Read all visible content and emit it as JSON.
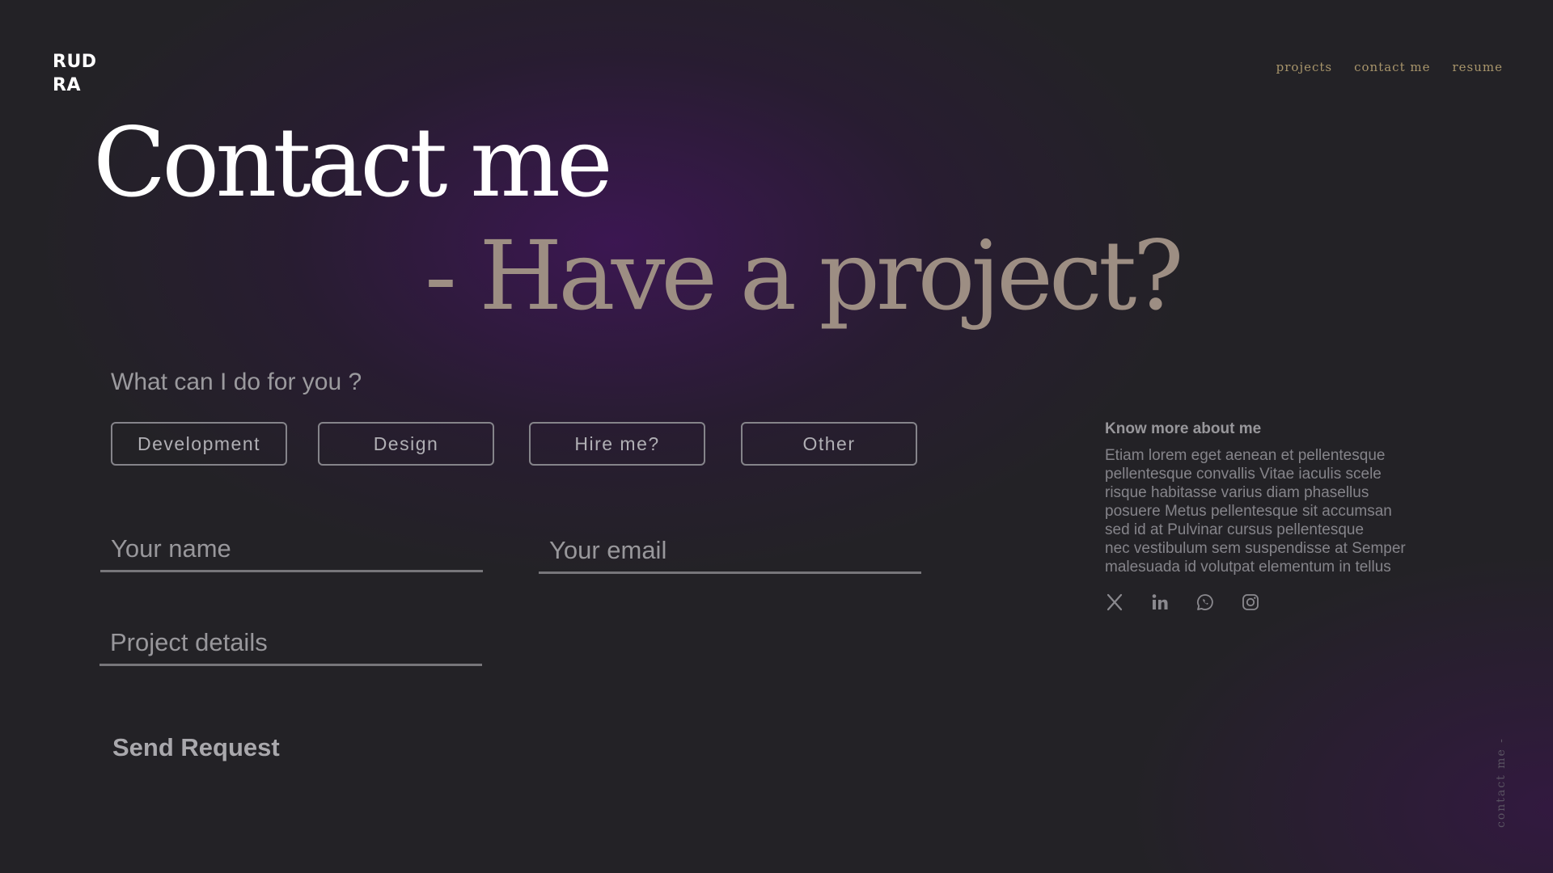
{
  "brand": {
    "line1": "RUD",
    "line2": "RA"
  },
  "nav": {
    "projects": "projects",
    "contact": "contact me",
    "resume": "resume"
  },
  "hero": {
    "title": "Contact me",
    "subtitle": "- Have a project?"
  },
  "form": {
    "question": "What can I do for you ?",
    "options": [
      "Development",
      "Design",
      "Hire me?",
      "Other"
    ],
    "name_placeholder": "Your name",
    "email_placeholder": "Your email",
    "details_placeholder": "Project details",
    "send_label": "Send Request"
  },
  "about": {
    "title": "Know more about me",
    "lines": [
      "Etiam lorem eget aenean et pellentesque",
      "pellentesque convallis Vitae iaculis scele",
      "risque habitasse varius diam phasellus",
      "posuere Metus pellentesque sit accumsan",
      "sed id at Pulvinar cursus pellentesque",
      "nec vestibulum sem suspendisse at Semper",
      "malesuada id volutpat elementum in tellus"
    ]
  },
  "socials": [
    "x-icon",
    "linkedin-icon",
    "whatsapp-icon",
    "instagram-icon"
  ],
  "side_label": "contact me -",
  "colors": {
    "background": "#232226",
    "glow": "#3d1654",
    "nav_gold": "#a8956b",
    "subtitle": "#9d8e83"
  }
}
